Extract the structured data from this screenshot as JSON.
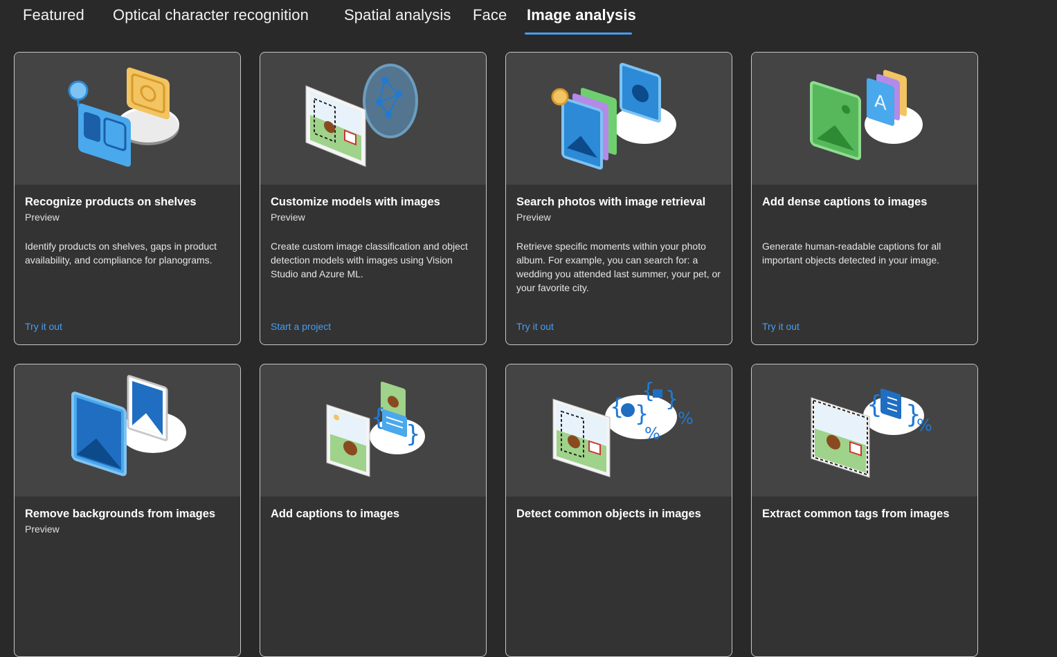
{
  "tabs": [
    {
      "label": "Featured"
    },
    {
      "label": "Optical character recognition"
    },
    {
      "label": "Spatial analysis"
    },
    {
      "label": "Face"
    },
    {
      "label": "Image analysis",
      "active": true
    }
  ],
  "colors": {
    "accent": "#479ef5",
    "card_bg": "#333333",
    "image_bg": "#444444",
    "page_bg": "#292929"
  },
  "cards": [
    {
      "title": "Recognize products on shelves",
      "badge": "Preview",
      "description": "Identify products on shelves, gaps in product availability, and compliance for planograms.",
      "action": "Try it out",
      "illustration": "products-shelf-illustration"
    },
    {
      "title": "Customize models with images",
      "badge": "Preview",
      "description": "Create custom image classification and object detection models with images using Vision Studio and Azure ML.",
      "action": "Start a project",
      "illustration": "custom-model-illustration"
    },
    {
      "title": "Search photos with image retrieval",
      "badge": "Preview",
      "description": "Retrieve specific moments within your photo album. For example, you can search for: a wedding you attended last summer, your pet, or your favorite city.",
      "action": "Try it out",
      "illustration": "image-retrieval-illustration"
    },
    {
      "title": "Add dense captions to images",
      "badge": "",
      "description": "Generate human-readable captions for all important objects detected in your image.",
      "action": "Try it out",
      "illustration": "dense-captions-illustration"
    },
    {
      "title": "Remove backgrounds from images",
      "badge": "Preview",
      "description": "",
      "action": "",
      "illustration": "remove-background-illustration"
    },
    {
      "title": "Add captions to images",
      "badge": "",
      "description": "",
      "action": "",
      "illustration": "captions-illustration"
    },
    {
      "title": "Detect common objects in images",
      "badge": "",
      "description": "",
      "action": "",
      "illustration": "object-detection-illustration"
    },
    {
      "title": "Extract common tags from images",
      "badge": "",
      "description": "",
      "action": "",
      "illustration": "tags-illustration"
    }
  ]
}
